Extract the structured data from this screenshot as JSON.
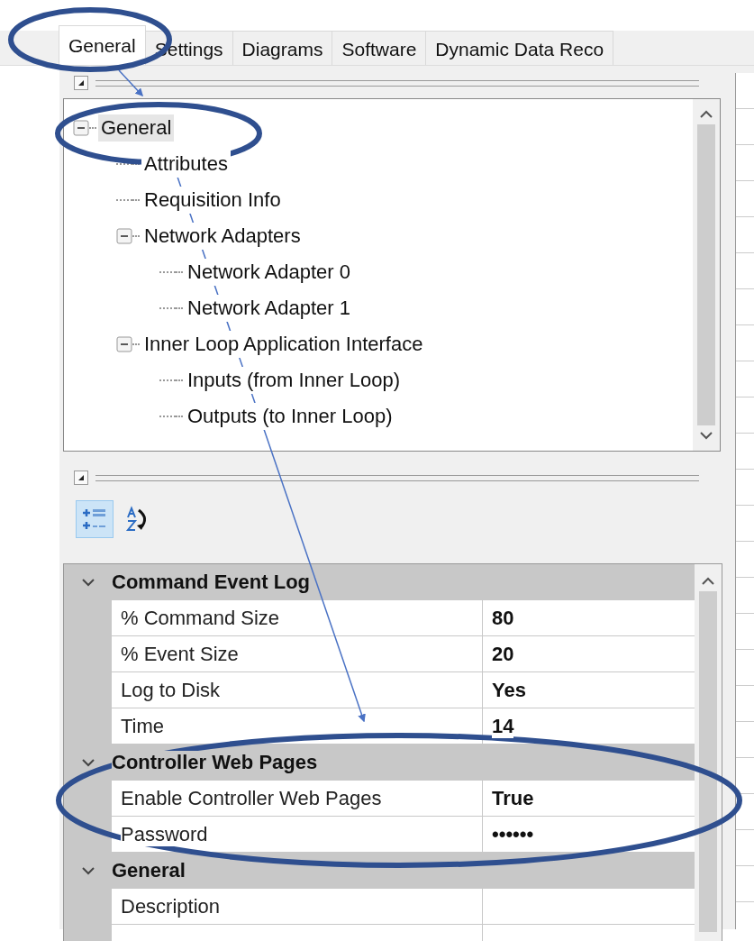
{
  "tabs": [
    {
      "label": "General",
      "selected": true
    },
    {
      "label": "Settings",
      "selected": false
    },
    {
      "label": "Diagrams",
      "selected": false
    },
    {
      "label": "Software",
      "selected": false
    },
    {
      "label": "Dynamic Data Reco",
      "selected": false
    }
  ],
  "tree": [
    {
      "label": "General",
      "selected": true,
      "expanded": true,
      "children": [
        {
          "label": "Attributes",
          "selected": false
        },
        {
          "label": "Requisition Info",
          "selected": false
        },
        {
          "label": "Network Adapters",
          "selected": false,
          "expanded": true,
          "children": [
            {
              "label": "Network Adapter 0",
              "selected": false
            },
            {
              "label": "Network Adapter 1",
              "selected": false
            }
          ]
        },
        {
          "label": "Inner Loop Application Interface",
          "selected": false,
          "expanded": true,
          "children": [
            {
              "label": "Inputs (from Inner Loop)",
              "selected": false
            },
            {
              "label": "Outputs (to Inner Loop)",
              "selected": false
            }
          ]
        }
      ]
    }
  ],
  "toolbar": [
    {
      "kind": "categorized",
      "selected": true
    },
    {
      "kind": "alphabetical",
      "selected": false
    }
  ],
  "property_grid": [
    {
      "category": "Command Event Log",
      "expanded": true,
      "properties": [
        {
          "name": "% Command Size",
          "value": "80"
        },
        {
          "name": "% Event Size",
          "value": "20"
        },
        {
          "name": "Log to Disk",
          "value": "Yes"
        },
        {
          "name": "Time",
          "value": "14"
        }
      ]
    },
    {
      "category": "Controller Web Pages",
      "expanded": true,
      "properties": [
        {
          "name": "Enable Controller Web Pages",
          "value": "True"
        },
        {
          "name": "Password",
          "value": "••••••"
        }
      ]
    },
    {
      "category": "General",
      "expanded": true,
      "properties": [
        {
          "name": "Description"
        }
      ]
    }
  ]
}
